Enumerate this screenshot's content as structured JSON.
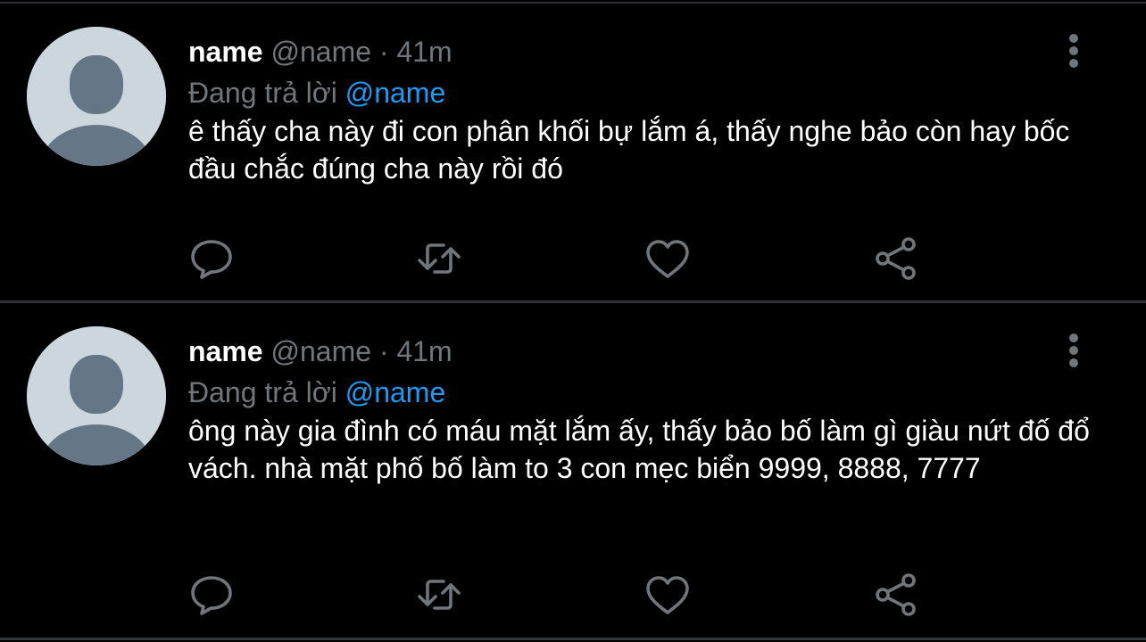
{
  "colors": {
    "background": "#000000",
    "divider": "#2f3336",
    "secondary_text": "#71767b",
    "mention": "#1d9bf0",
    "avatar_bg": "#ccd6dd",
    "avatar_fg": "#657786"
  },
  "replies": [
    {
      "display_name": "name",
      "handle": "@name",
      "separator": "·",
      "time": "41m",
      "replying_label": "Đang trả lời",
      "replying_to": "@name",
      "text": "ê thấy cha này đi con phân khối bự lắm á, thấy nghe bảo còn hay bốc đầu chắc đúng cha này rồi đó",
      "icons": [
        "reply-icon",
        "retweet-icon",
        "like-icon",
        "share-icon",
        "more-icon"
      ]
    },
    {
      "display_name": "name",
      "handle": "@name",
      "separator": "·",
      "time": "41m",
      "replying_label": "Đang trả lời",
      "replying_to": "@name",
      "text": "ông này gia đình có máu mặt lắm ấy, thấy bảo bố làm gì giàu nứt đố đổ vách. nhà mặt phố bố làm to 3 con mẹc biển 9999, 8888, 7777",
      "icons": [
        "reply-icon",
        "retweet-icon",
        "like-icon",
        "share-icon",
        "more-icon"
      ]
    }
  ]
}
